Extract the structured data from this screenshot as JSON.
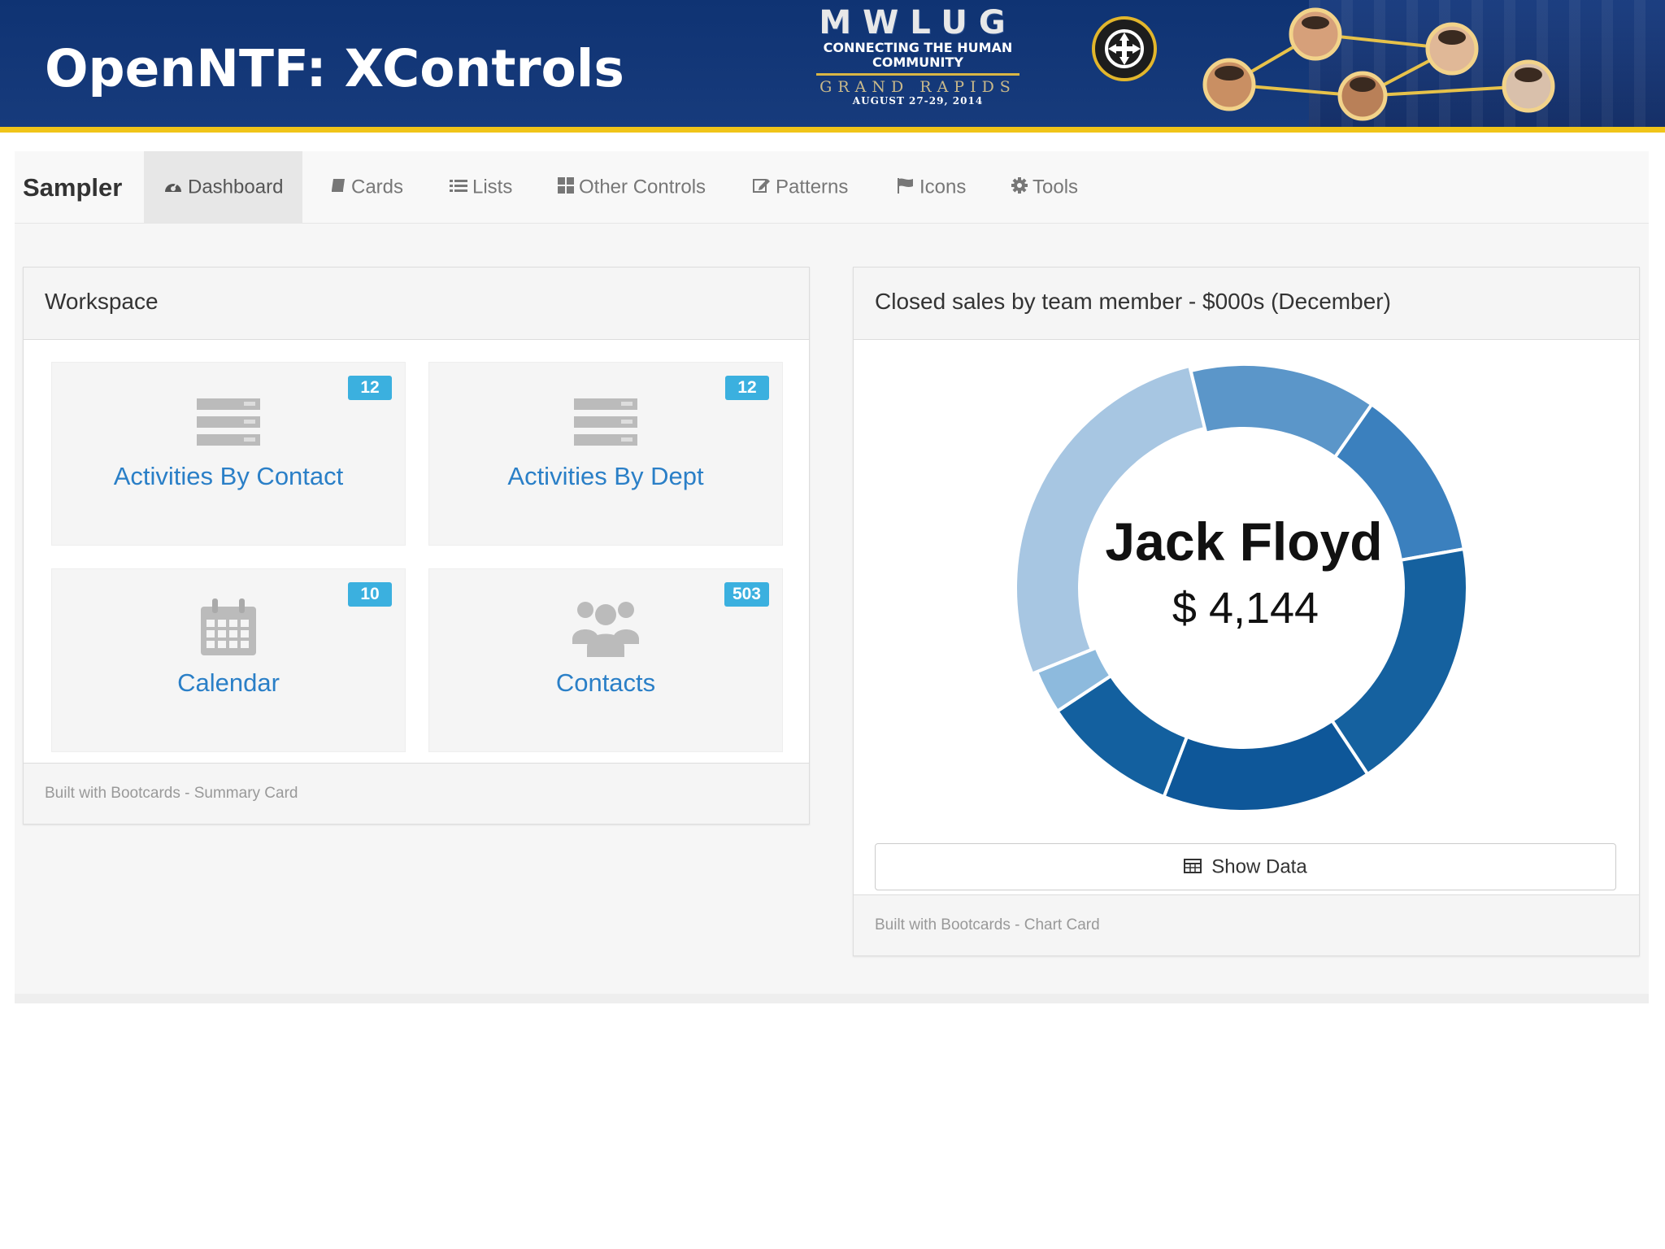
{
  "slide": {
    "title": "OpenNTF: XControls",
    "conference": {
      "name": "MWLUG",
      "tagline_1": "CONNECTING THE HUMAN",
      "tagline_2": "COMMUNITY",
      "city": "GRAND RAPIDS",
      "date": "AUGUST 27-29, 2014"
    },
    "colors": {
      "banner": "#173b7c",
      "accent": "#f0c419"
    }
  },
  "navbar": {
    "brand": "Sampler",
    "items": [
      {
        "label": "Dashboard",
        "icon": "dashboard-icon",
        "active": true
      },
      {
        "label": "Cards",
        "icon": "book-icon",
        "active": false
      },
      {
        "label": "Lists",
        "icon": "list-icon",
        "active": false
      },
      {
        "label": "Other Controls",
        "icon": "grid-icon",
        "active": false
      },
      {
        "label": "Patterns",
        "icon": "edit-icon",
        "active": false
      },
      {
        "label": "Icons",
        "icon": "flag-icon",
        "active": false
      },
      {
        "label": "Tools",
        "icon": "gear-icon",
        "active": false
      }
    ]
  },
  "workspace": {
    "title": "Workspace",
    "tiles": [
      {
        "label": "Activities By Contact",
        "badge": "12",
        "icon": "stack-icon"
      },
      {
        "label": "Activities By Dept",
        "badge": "12",
        "icon": "stack-icon"
      },
      {
        "label": "Calendar",
        "badge": "10",
        "icon": "calendar-icon"
      },
      {
        "label": "Contacts",
        "badge": "503",
        "icon": "users-icon"
      }
    ],
    "footer": "Built with Bootcards - Summary Card",
    "colors": {
      "badge": "#3bb0df",
      "link": "#2a7fc7"
    }
  },
  "chart_card": {
    "title": "Closed sales by team member - $000s (December)",
    "center_name": "Jack Floyd",
    "center_value": "$ 4,144",
    "button_label": "Show Data",
    "footer": "Built with Bootcards - Chart Card"
  },
  "chart_data": {
    "type": "pie",
    "title": "Closed sales by team member - $000s (December)",
    "unit": "$000s",
    "highlighted": {
      "name": "Jack Floyd",
      "value": 4144
    },
    "values": [
      4144,
      2050,
      1900,
      2800,
      2300,
      1500,
      480
    ],
    "colors": [
      "#a7c6e2",
      "#5b96c9",
      "#3b80be",
      "#15619f",
      "#0e5799",
      "#13609f",
      "#8dbadd"
    ]
  }
}
